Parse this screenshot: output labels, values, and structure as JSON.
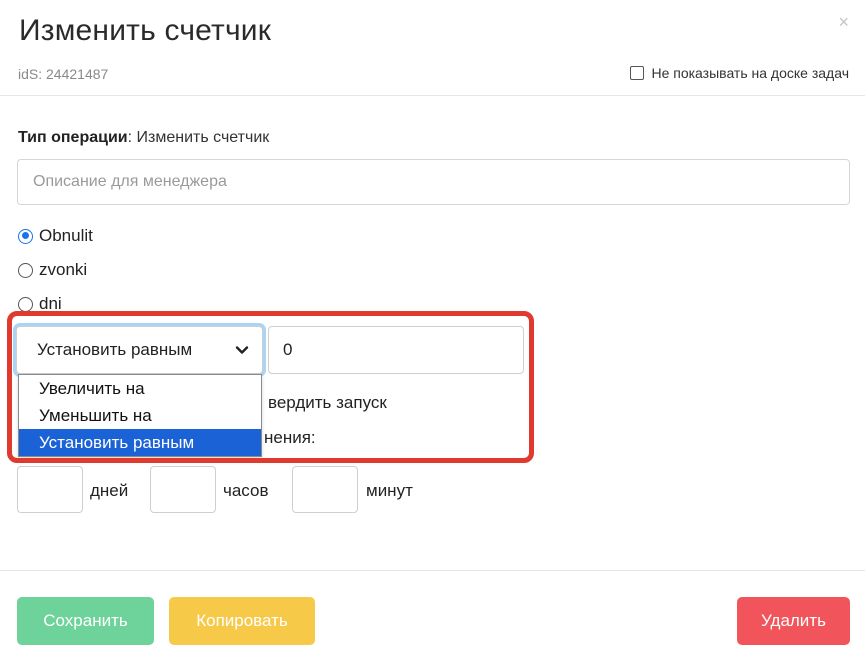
{
  "header": {
    "title": "Изменить счетчик",
    "close_symbol": "×",
    "ids_label": "idS: 24421487",
    "hide_label": "Не показывать на доске задач"
  },
  "form": {
    "op_type_label": "Тип операции",
    "op_type_value": ": Изменить счетчик",
    "desc_placeholder": "Описание для менеджера",
    "counters": [
      {
        "label": "Obnulit",
        "checked": true
      },
      {
        "label": "zvonki",
        "checked": false
      },
      {
        "label": "dni",
        "checked": false
      }
    ],
    "operation_select": {
      "selected": "Установить равным",
      "options": [
        "Увеличить на",
        "Уменьшить на",
        "Установить равным"
      ]
    },
    "value": "0",
    "confirm_partial": "вердить запуск",
    "exec_partial": "нения:",
    "time": {
      "days_label": "дней",
      "hours_label": "часов",
      "minutes_label": "минут"
    }
  },
  "footer": {
    "save_label": "Сохранить",
    "copy_label": "Копировать",
    "delete_label": "Удалить"
  },
  "colors": {
    "save": "#6dd39a",
    "copy": "#f7c948",
    "delete": "#f2545b",
    "highlight": "#e03a2f",
    "selected_option": "#1a62d6"
  }
}
